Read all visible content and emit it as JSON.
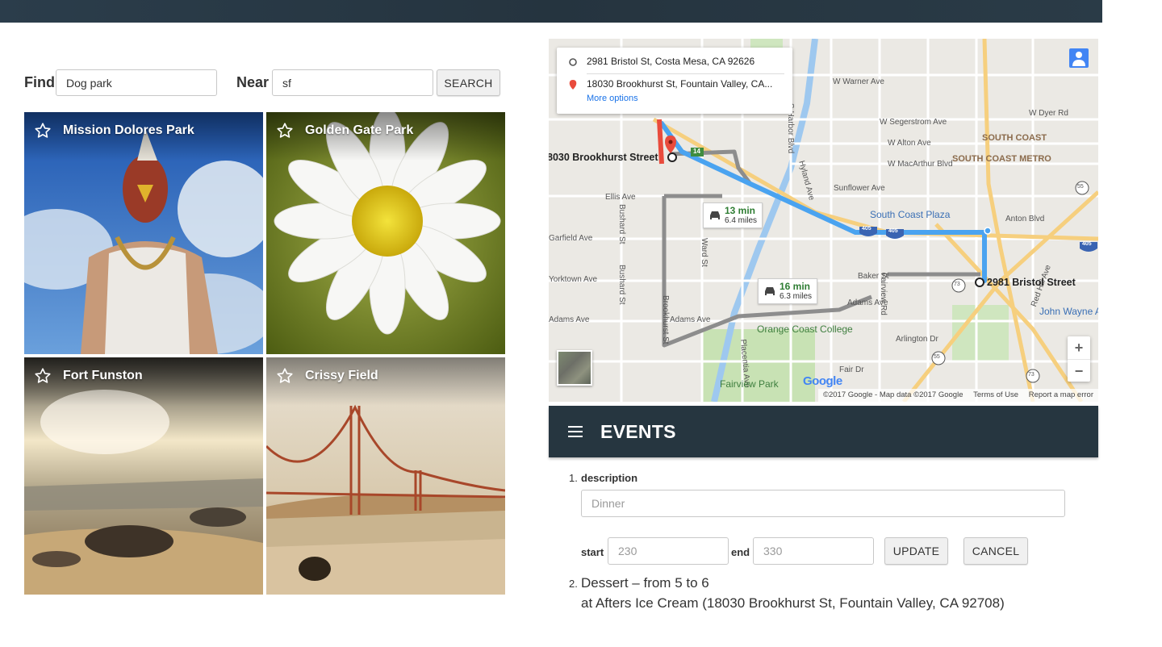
{
  "search": {
    "find_label": "Find",
    "find_value": "Dog park",
    "near_label": "Near",
    "near_value": "sf",
    "button_label": "SEARCH"
  },
  "tiles": [
    {
      "title": "Mission Dolores Park",
      "starred": false
    },
    {
      "title": "Golden Gate Park",
      "starred": false
    },
    {
      "title": "Fort Funston",
      "starred": false
    },
    {
      "title": "Crissy Field",
      "starred": false
    }
  ],
  "map": {
    "from": "2981 Bristol St, Costa Mesa, CA 92626",
    "to": "18030 Brookhurst St, Fountain Valley, CA...",
    "more_options": "More options",
    "routes": [
      {
        "time": "13 min",
        "distance": "6.4 miles"
      },
      {
        "time": "16 min",
        "distance": "6.3 miles"
      }
    ],
    "pins": {
      "start": "2981 Bristol Street",
      "end": "8030 Brookhurst Street"
    },
    "labels": {
      "warner": "W Warner Ave",
      "segerstrom": "W Segerstrom Ave",
      "dyer": "W Dyer Rd",
      "alton": "W Alton Ave",
      "macarthur": "W MacArthur Blvd",
      "sunflower": "Sunflower Ave",
      "anton": "Anton Blvd",
      "ellis": "Ellis Ave",
      "garfield": "Garfield Ave",
      "yorktown": "Yorktown Ave",
      "adams_left": "Adams Ave",
      "adams_mid": "Adams Ave",
      "adams_right": "Adams Ave",
      "baker": "Baker St",
      "arlington": "Arlington Dr",
      "fair": "Fair Dr",
      "harbor": "S Harbor Blvd",
      "hyland": "Hyland Ave",
      "bushard": "Bushard St",
      "bushard2": "Bushard St",
      "brookhurst": "Brookhurst St",
      "ward": "Ward St",
      "fairview": "Fairview Rd",
      "placentia": "Placentia Ave",
      "redhill": "Red Hill Ave",
      "south_coast": "SOUTH COAST",
      "south_coast_metro": "SOUTH COAST METRO",
      "south_coast_plaza": "South Coast Plaza",
      "orange_coast": "Orange Coast College",
      "fairview_park": "Fairview Park",
      "john_wayne": "John Wayne Airport",
      "hwy405a": "405",
      "hwy405b": "405",
      "hwy405c": "405",
      "hwy55a": "55",
      "hwy55b": "55",
      "hwy73a": "73",
      "hwy73b": "73",
      "exit14": "14"
    },
    "footer": {
      "copyright": "©2017 Google - Map data ©2017 Google",
      "terms": "Terms of Use",
      "report": "Report a map error"
    },
    "google_logo": "Google",
    "zoom_in": "+",
    "zoom_out": "−"
  },
  "events": {
    "title": "EVENTS",
    "item1": {
      "number": "1.",
      "description_label": "description",
      "description_placeholder": "Dinner",
      "start_label": "start",
      "start_placeholder": "230",
      "end_label": "end",
      "end_placeholder": "330",
      "update_label": "UPDATE",
      "cancel_label": "CANCEL"
    },
    "item2": {
      "number": "2.",
      "line1": "Dessert – from 5 to 6",
      "line2": "at Afters Ice Cream (18030 Brookhurst St, Fountain Valley, CA 92708)"
    }
  },
  "colors": {
    "header_bg": "#263640",
    "route_blue": "#4aa3f0",
    "route_alt": "#9e9e9e"
  }
}
